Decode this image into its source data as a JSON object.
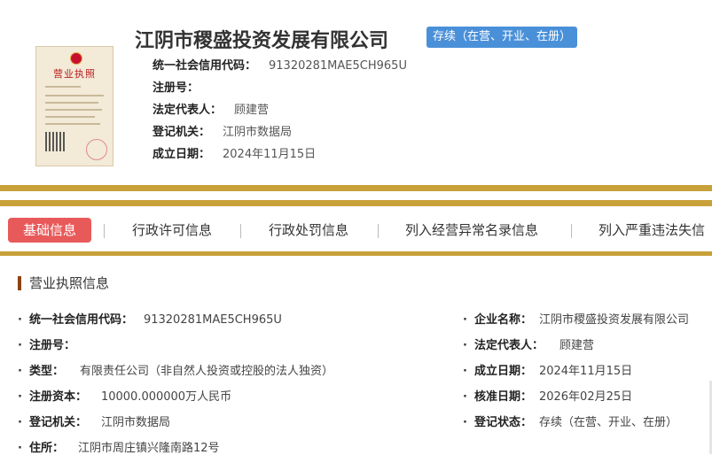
{
  "company": {
    "name": "江阴市稷盛投资发展有限公司",
    "status": "存续（在营、开业、在册）"
  },
  "license_image": {
    "title": "营业执照"
  },
  "header_fields": [
    {
      "label": "统一社会信用代码：",
      "value": "91320281MAE5CH965U"
    },
    {
      "label": "注册号：",
      "value": ""
    },
    {
      "label": "法定代表人：",
      "value": "顾建营"
    },
    {
      "label": "登记机关：",
      "value": "江阴市数据局"
    },
    {
      "label": "成立日期：",
      "value": "2024年11月15日"
    }
  ],
  "tabs": [
    "基础信息",
    "行政许可信息",
    "行政处罚信息",
    "列入经营异常名录信息",
    "列入严重违法失信"
  ],
  "section": {
    "title": "营业执照信息"
  },
  "details_left": [
    {
      "label": "统一社会信用代码：",
      "value": "91320281MAE5CH965U"
    },
    {
      "label": "注册号：",
      "value": ""
    },
    {
      "label": "类型：",
      "value": "有限责任公司（非自然人投资或控股的法人独资）"
    },
    {
      "label": "注册资本：",
      "value": "10000.000000万人民币"
    },
    {
      "label": "登记机关：",
      "value": "江阴市数据局"
    },
    {
      "label": "住所：",
      "value": "江阴市周庄镇兴隆南路12号"
    }
  ],
  "details_right": [
    {
      "label": "企业名称：",
      "value": "江阴市稷盛投资发展有限公司"
    },
    {
      "label": "法定代表人：",
      "value": "顾建营"
    },
    {
      "label": "成立日期：",
      "value": "2024年11月15日"
    },
    {
      "label": "核准日期：",
      "value": "2026年02月25日"
    },
    {
      "label": "登记状态：",
      "value": "存续（在营、开业、在册）"
    }
  ],
  "colors": {
    "gold": "#c9a13a",
    "active_tab": "#e85a5a",
    "badge": "#4a90d9",
    "section_marker": "#8b4513"
  }
}
